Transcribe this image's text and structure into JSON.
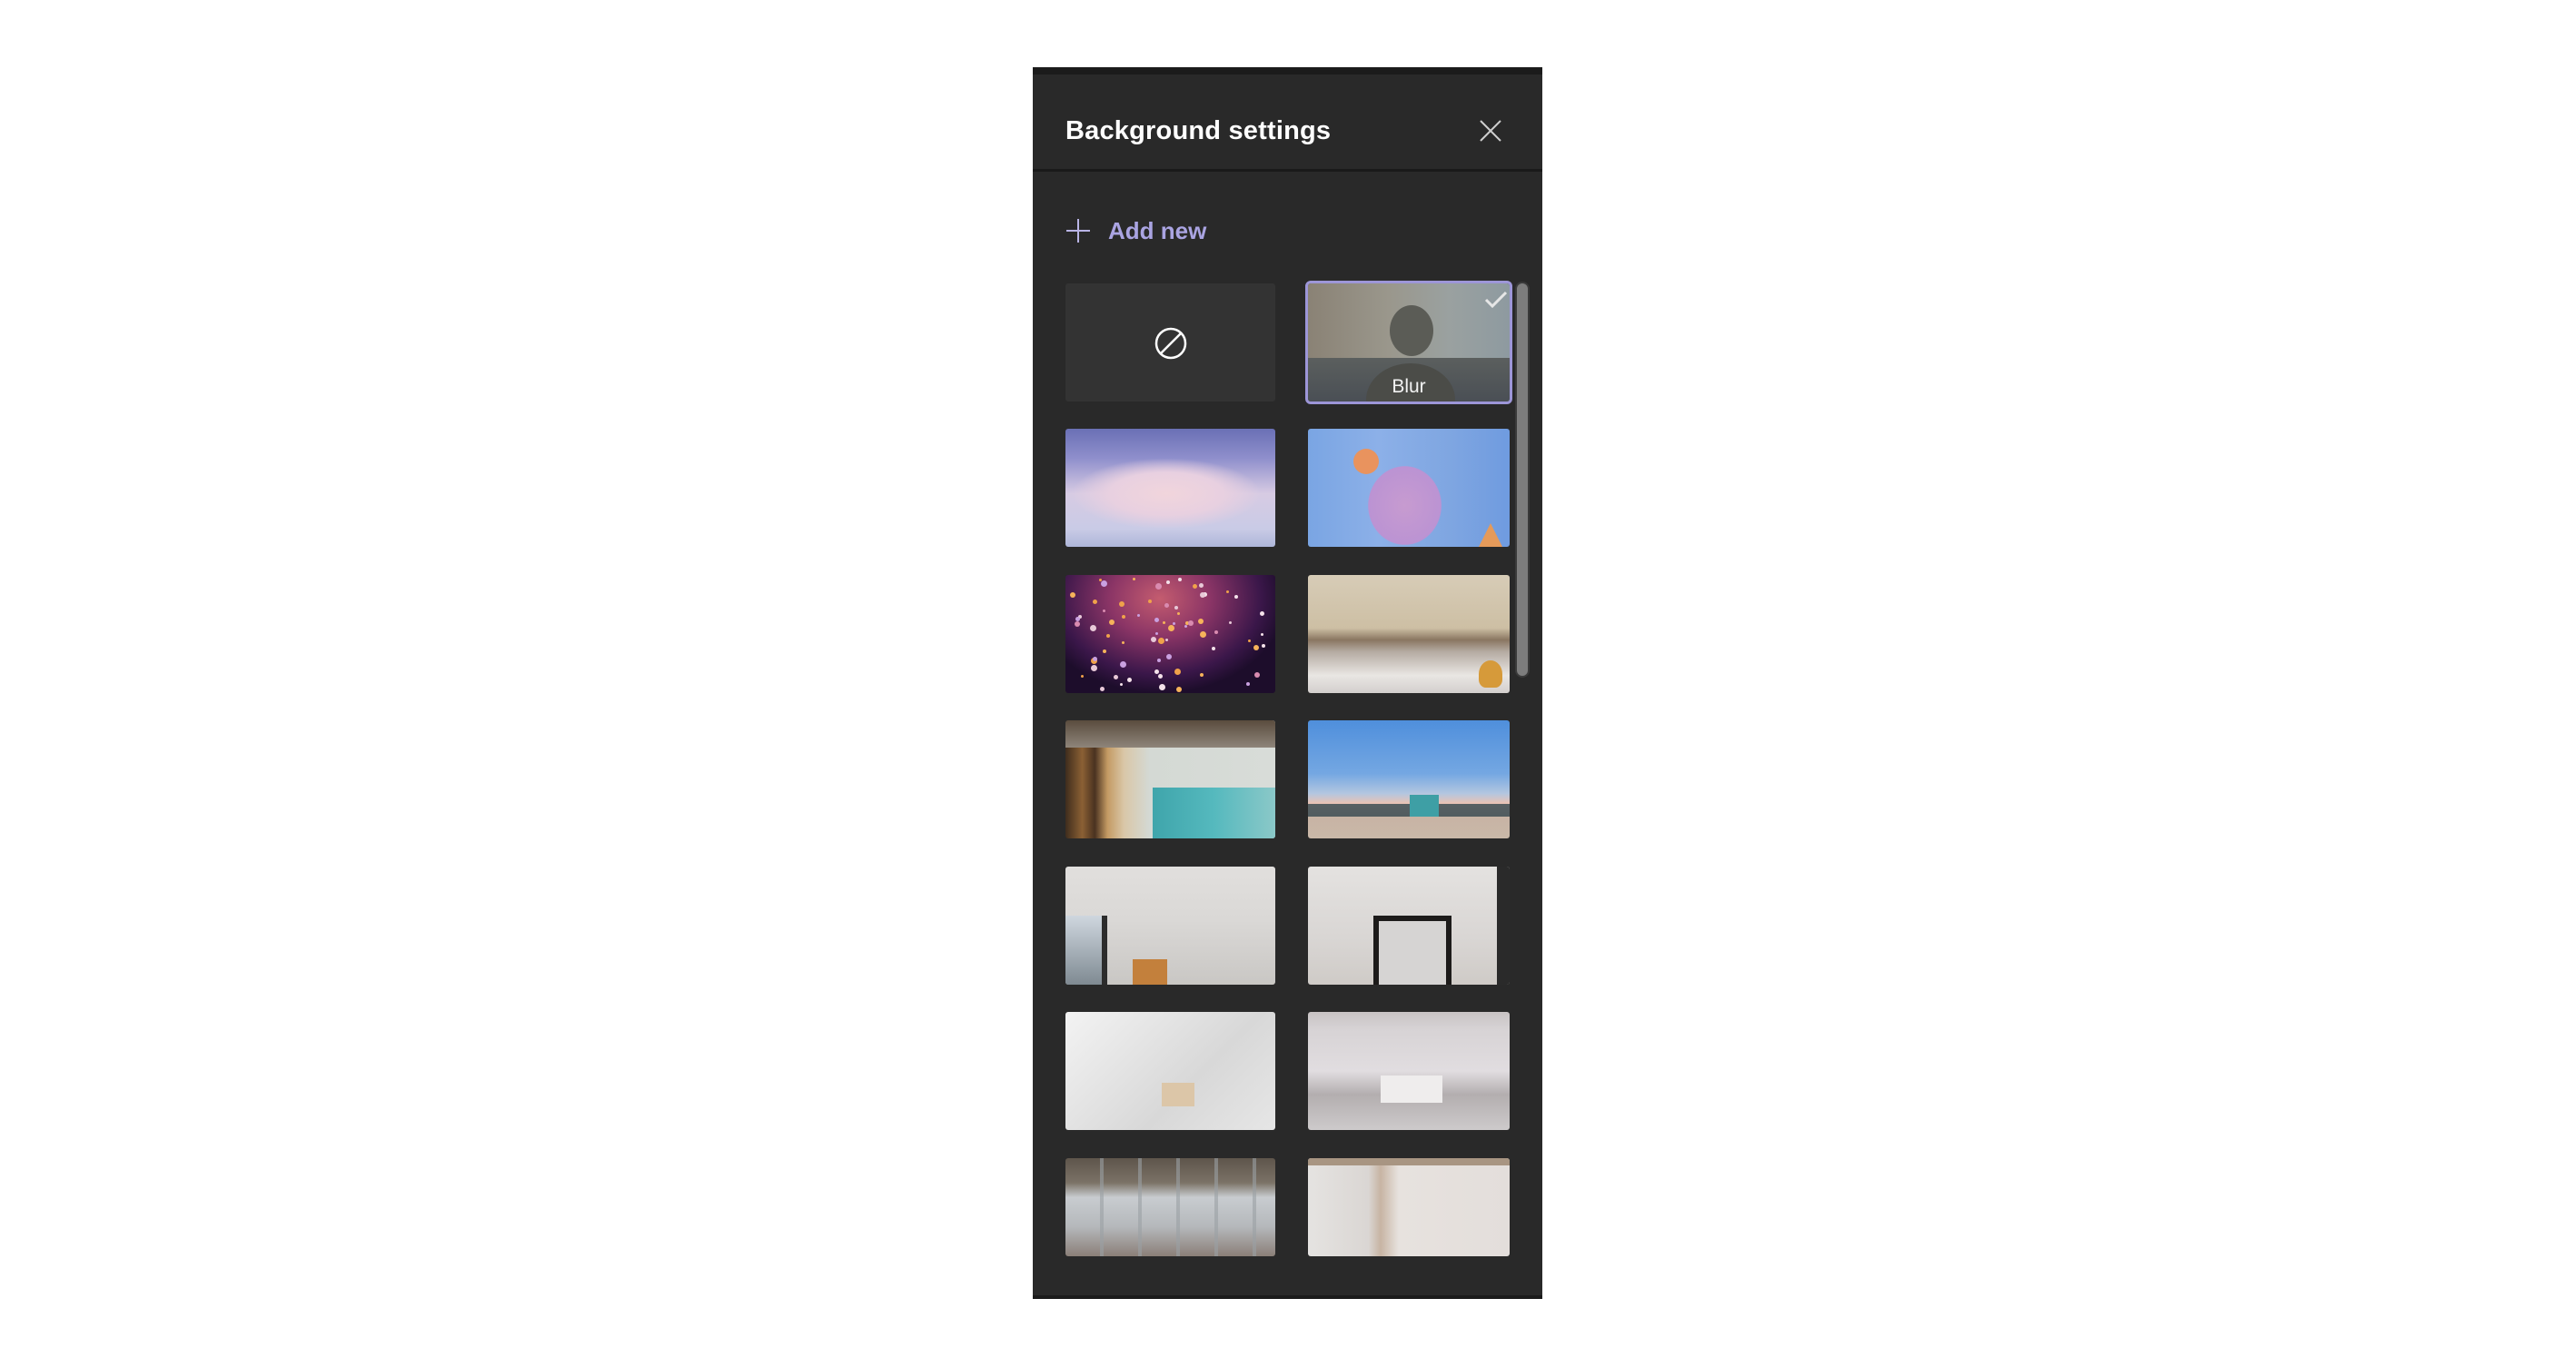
{
  "panel": {
    "title": "Background settings",
    "close_icon": "close-icon",
    "add_new": {
      "icon": "plus-icon",
      "label": "Add new"
    },
    "colors": {
      "accent": "#9d96d8",
      "add_new_text": "#aaa4e2",
      "panel_bg": "#292929"
    },
    "backgrounds": [
      {
        "id": "none",
        "label": "",
        "icon": "no-background-icon",
        "selected": false
      },
      {
        "id": "blur",
        "label": "Blur",
        "icon": "checkmark-icon",
        "selected": true
      },
      {
        "id": "ice-cave",
        "label": "",
        "selected": false
      },
      {
        "id": "paper-arch",
        "label": "",
        "selected": false
      },
      {
        "id": "confetti",
        "label": "",
        "selected": false
      },
      {
        "id": "blanket-fort",
        "label": "",
        "selected": false
      },
      {
        "id": "office-lockers",
        "label": "",
        "selected": false
      },
      {
        "id": "beach-lifeguard",
        "label": "",
        "selected": false
      },
      {
        "id": "white-room-window",
        "label": "",
        "selected": false
      },
      {
        "id": "white-room-mirror",
        "label": "",
        "selected": false
      },
      {
        "id": "bright-loft",
        "label": "",
        "selected": false
      },
      {
        "id": "minimal-bedroom",
        "label": "",
        "selected": false
      },
      {
        "id": "industrial-loft",
        "label": "",
        "selected": false
      },
      {
        "id": "plain-wall",
        "label": "",
        "selected": false
      }
    ]
  }
}
